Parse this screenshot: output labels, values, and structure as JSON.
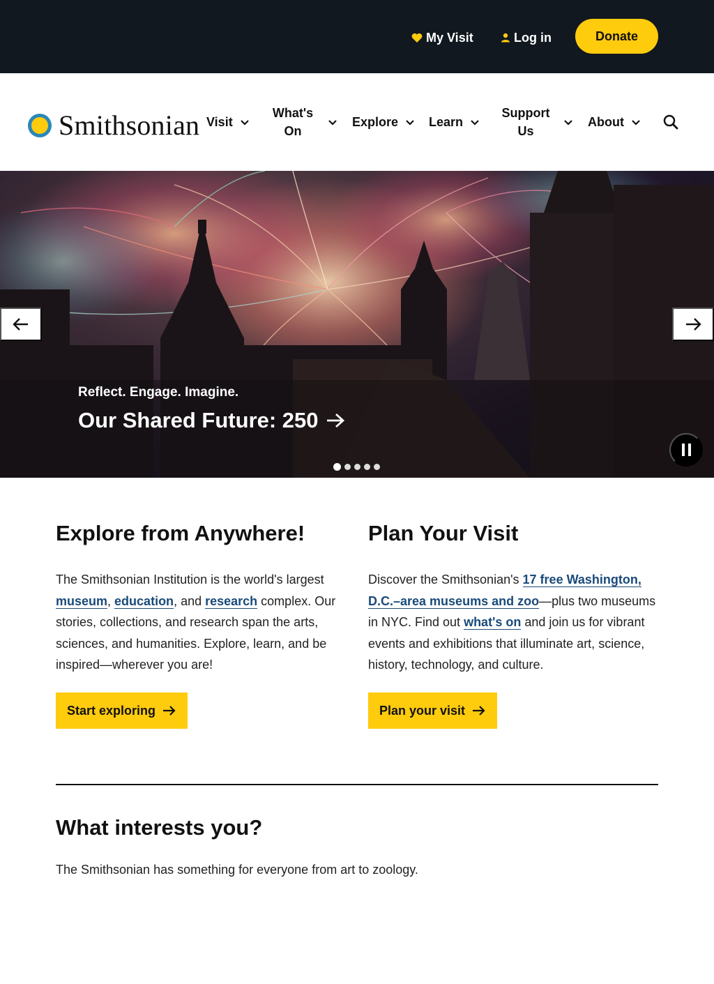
{
  "utility": {
    "my_visit": "My Visit",
    "log_in": "Log in",
    "donate": "Donate"
  },
  "header": {
    "logo_text": "Smithsonian",
    "nav": [
      {
        "line1": "Visit",
        "line2": ""
      },
      {
        "line1": "What's",
        "line2": "On"
      },
      {
        "line1": "Explore",
        "line2": ""
      },
      {
        "line1": "Learn",
        "line2": ""
      },
      {
        "line1": "Support",
        "line2": "Us"
      },
      {
        "line1": "About",
        "line2": ""
      }
    ]
  },
  "hero": {
    "kicker": "Reflect. Engage. Imagine.",
    "title": "Our Shared Future: 250",
    "slide_count": 5,
    "active_slide": 1
  },
  "explore": {
    "title": "Explore from Anywhere!",
    "text_1": "The Smithsonian Institution is the world's largest ",
    "link_museum": "museum",
    "sep_1": ", ",
    "link_education": "education",
    "sep_2": ", and ",
    "link_research": "research",
    "text_2": " complex. Our stories, collections, and research span the arts, sciences, and humanities. Explore, learn, and be inspired—wherever you are!",
    "cta": "Start exploring"
  },
  "plan": {
    "title": "Plan Your Visit",
    "text_1": "Discover the Smithsonian's ",
    "link_museums": "17 free Washington, D.C.–area museums and zoo",
    "text_2": "—plus two museums in NYC. Find out ",
    "link_whats_on": "what's on",
    "text_3": " and join us for vibrant events and exhibitions that illuminate art, science, history, technology, and culture.",
    "cta": "Plan your visit"
  },
  "interests": {
    "title": "What interests you?",
    "text": "The Smithsonian has something for everyone from art to zoology."
  },
  "colors": {
    "brand_yellow": "#FFCB0D",
    "dark_bar": "#111820",
    "link_blue": "#1A4A7A"
  }
}
